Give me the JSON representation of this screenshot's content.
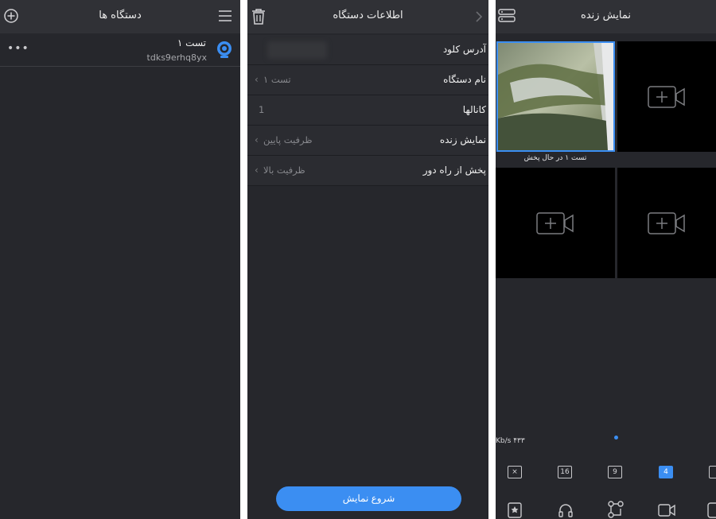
{
  "devices_screen": {
    "title": "دستگاه ها",
    "device": {
      "name": "تست ۱",
      "serial": "tdks9erhq8yx",
      "more": "•••"
    }
  },
  "device_info_screen": {
    "title": "اطلاعات دستگاه",
    "rows": [
      {
        "label": "آدرس کلود",
        "value": ""
      },
      {
        "label": "نام دستگاه",
        "value": "تست ۱"
      },
      {
        "label": "کانالها",
        "value": "1"
      },
      {
        "label": "نمایش زنده",
        "value": "ظرفیت پایین"
      },
      {
        "label": "پخش از راه دور",
        "value": "ظرفیت بالا"
      }
    ],
    "start_button": "شروع نمایش"
  },
  "live_view_screen": {
    "title": "نمایش زنده",
    "tile_caption": "تست ۱  در حال پخش",
    "bitrate": "Kb/s ۴۳۳",
    "layout_buttons": [
      "×",
      "16",
      "9",
      "4"
    ],
    "accent": "#3b8ef2"
  },
  "colors": {
    "background": "#26272c",
    "header": "#303136",
    "accent": "#3b8ef2"
  }
}
